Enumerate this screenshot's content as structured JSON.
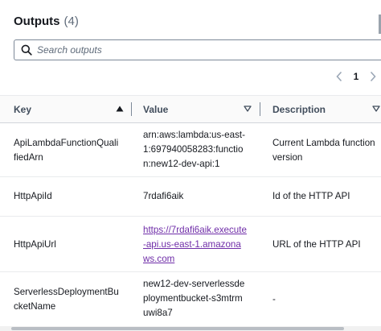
{
  "header": {
    "title": "Outputs",
    "count": "(4)"
  },
  "search": {
    "placeholder": "Search outputs",
    "value": ""
  },
  "pagination": {
    "current_page": "1",
    "prev_icon": "chevron-left-icon",
    "next_icon": "chevron-right-icon"
  },
  "table": {
    "columns": [
      {
        "label": "Key",
        "sort": "ascending"
      },
      {
        "label": "Value",
        "sort": "none"
      },
      {
        "label": "Description",
        "sort": "none"
      }
    ],
    "rows": [
      {
        "key": "ApiLambdaFunctionQualifiedArn",
        "value": "arn:aws:lambda:us-east-1:697940058283:function:new12-dev-api:1",
        "value_is_link": false,
        "description": "Current Lambda function version"
      },
      {
        "key": "HttpApiId",
        "value": "7rdafi6aik",
        "value_is_link": false,
        "description": "Id of the HTTP API"
      },
      {
        "key": "HttpApiUrl",
        "value": "https://7rdafi6aik.execute-api.us-east-1.amazonaws.com",
        "value_is_link": true,
        "description": "URL of the HTTP API"
      },
      {
        "key": "ServerlessDeploymentBucketName",
        "value": "new12-dev-serverlessdeploymentbucket-s3mtrmuwi8a7",
        "value_is_link": false,
        "description": "-"
      }
    ]
  },
  "colors": {
    "text": "#16191f",
    "link_visited": "#6f2da8",
    "header_bg": "#fafafa",
    "border": "#e9ebed"
  }
}
